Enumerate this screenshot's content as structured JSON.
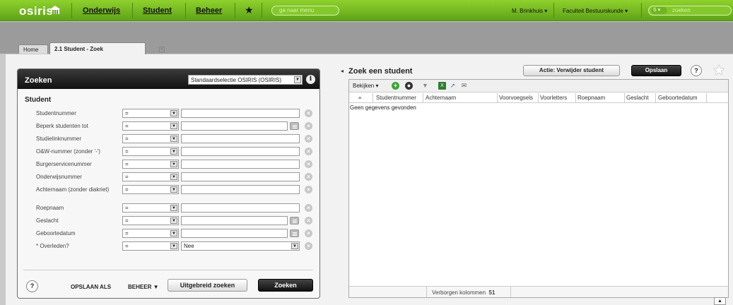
{
  "app": {
    "logo": "osiris",
    "menu": [
      {
        "label": "Onderwijs"
      },
      {
        "label": "Student"
      },
      {
        "label": "Beheer"
      }
    ],
    "goto_placeholder": "ga naar menu",
    "user": "M. Brinkhuis",
    "faculty": "Faculteit Bestuurskunde",
    "search_scope": "S",
    "search_placeholder": "zoeken"
  },
  "tabs": [
    {
      "label": "Home"
    },
    {
      "label": "2.1 Student - Zoek",
      "active": true
    }
  ],
  "search_panel": {
    "title": "Zoeken",
    "selection": "Standaardselectie OSIRIS (OSIRIS)",
    "section": "Student",
    "fields": [
      {
        "label": "Studentnummer",
        "operator": "=",
        "value": ""
      },
      {
        "label": "Beperk studenten tot",
        "operator": "=",
        "value": "",
        "lookup": true
      },
      {
        "label": "Studielinknummer",
        "operator": "=",
        "value": ""
      },
      {
        "label": "O&W-nummer (zonder '-')",
        "operator": "=",
        "value": ""
      },
      {
        "label": "Burgerservicenummer",
        "operator": "=",
        "value": ""
      },
      {
        "label": "Onderwijsnummer",
        "operator": "=",
        "value": ""
      },
      {
        "label": "Achternaam (zonder diakriet)",
        "operator": "=",
        "value": ""
      },
      {
        "label": "Roepnaam",
        "operator": "=",
        "value": ""
      },
      {
        "label": "Geslacht",
        "operator": "=",
        "value": "",
        "lookup": true
      },
      {
        "label": "Geboortedatum",
        "operator": "=",
        "value": "",
        "lookup": true
      },
      {
        "label": "* Overleden?",
        "operator": "=",
        "value": "Nee",
        "dropdown": true
      }
    ],
    "footer": {
      "help": "?",
      "save_as": "OPSLAAN ALS",
      "manage": "BEHEER",
      "advanced": "Uitgebreid zoeken",
      "search": "Zoeken"
    }
  },
  "results": {
    "title": "Zoek een student",
    "action_button": "Actie: Verwijder student",
    "save_button": "Opslaan",
    "help": "?",
    "view_menu": "Bekijken",
    "columns": [
      "Studentnummer",
      "Achternaam",
      "Voorvoegsels",
      "Voorletters",
      "Roepnaam",
      "Geslacht",
      "Geboortedatum"
    ],
    "empty_message": "Geen gegevens gevonden",
    "hidden_columns_label": "Verborgen kolommen",
    "hidden_columns_count": "51"
  },
  "colors": {
    "topbar": "#6fb522",
    "panel_header": "#111111",
    "primary_button": "#222222"
  }
}
